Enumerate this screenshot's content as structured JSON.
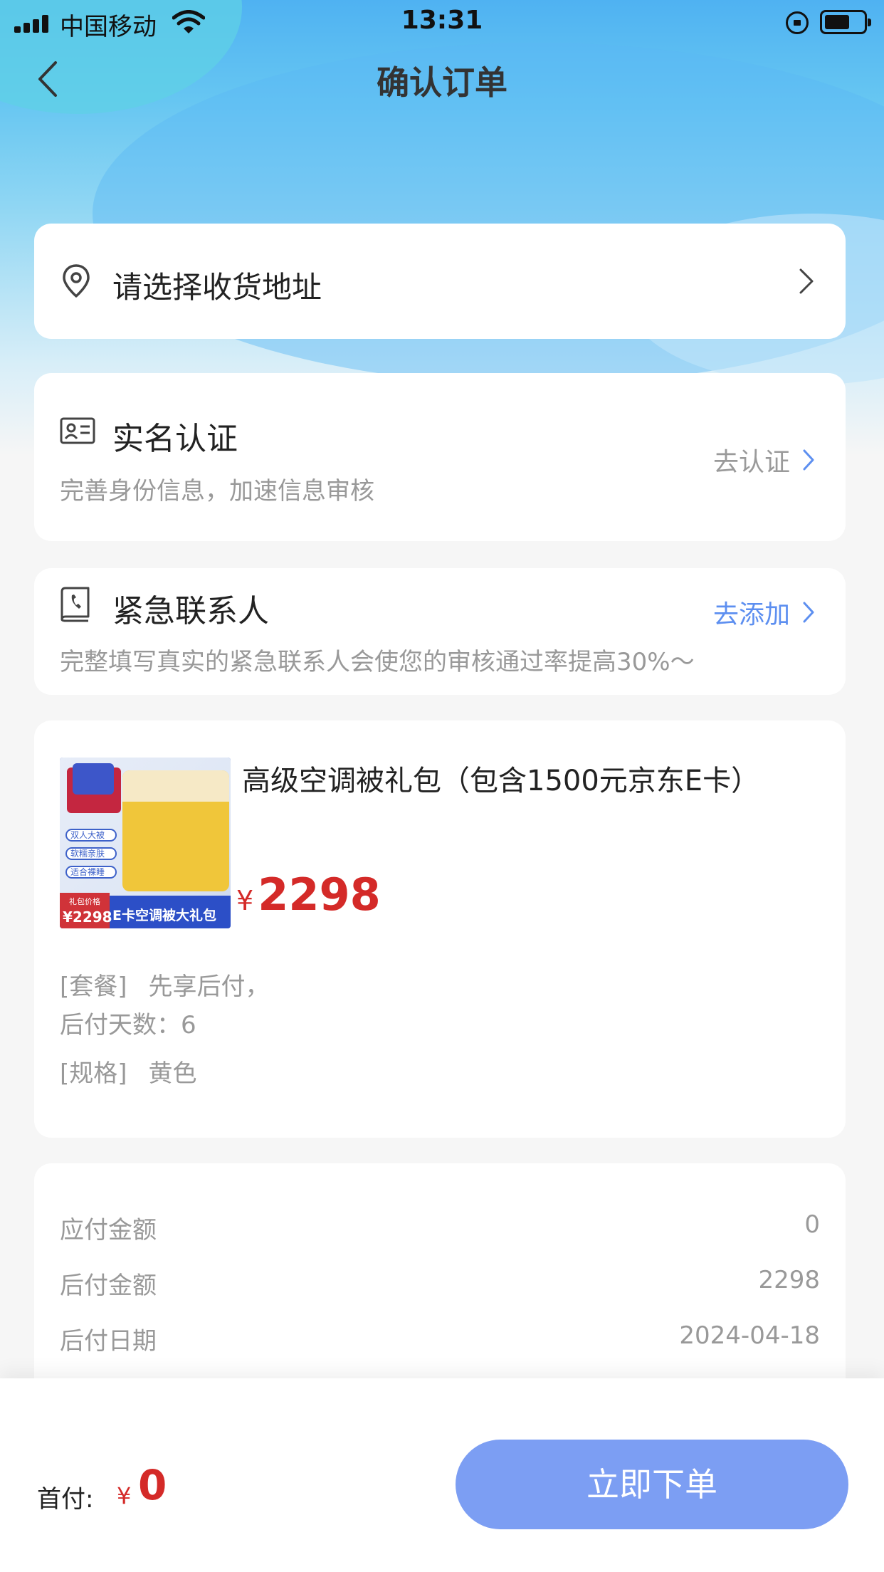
{
  "status_bar": {
    "carrier": "中国移动",
    "time": "13:31"
  },
  "nav": {
    "title": "确认订单"
  },
  "address": {
    "placeholder_text": "请选择收货地址"
  },
  "verification": {
    "title": "实名认证",
    "subtitle": "完善身份信息，加速信息审核",
    "action_label": "去认证"
  },
  "emergency_contact": {
    "title": "紧急联系人",
    "subtitle": "完整填写真实的紧急联系人会使您的审核通过率提高30%～",
    "action_label": "去添加"
  },
  "product": {
    "name": "高级空调被礼包（包含1500元京东E卡）",
    "currency_symbol": "¥",
    "price": "2298",
    "thumbnail": {
      "tags": [
        "双人大被",
        "软糯亲肤",
        "适合裸睡"
      ],
      "price_label": "礼包价格",
      "price_text": "¥2298",
      "banner_text": "E卡空调被大礼包"
    },
    "package_key": "[套餐]",
    "package_value": "先享后付，",
    "deferred_days_label": "后付天数：",
    "deferred_days_value": "6",
    "spec_key": "[规格]",
    "spec_value": "黄色"
  },
  "payment": {
    "rows": [
      {
        "label": "应付金额",
        "value": "0"
      },
      {
        "label": "后付金额",
        "value": "2298"
      },
      {
        "label": "后付日期",
        "value": "2024-04-18"
      }
    ]
  },
  "bottom": {
    "down_payment_label": "首付:",
    "currency_symbol": "¥",
    "down_payment_value": "0",
    "submit_label": "立即下单"
  },
  "colors": {
    "accent_blue": "#5d8ff0",
    "price_red": "#d42a28",
    "button_blue": "#7c9ef3"
  },
  "icons": [
    "signal-icon",
    "wifi-icon",
    "rotation-lock-icon",
    "battery-icon",
    "back-icon",
    "location-pin-icon",
    "chevron-right-icon",
    "id-card-icon",
    "contact-book-icon"
  ]
}
